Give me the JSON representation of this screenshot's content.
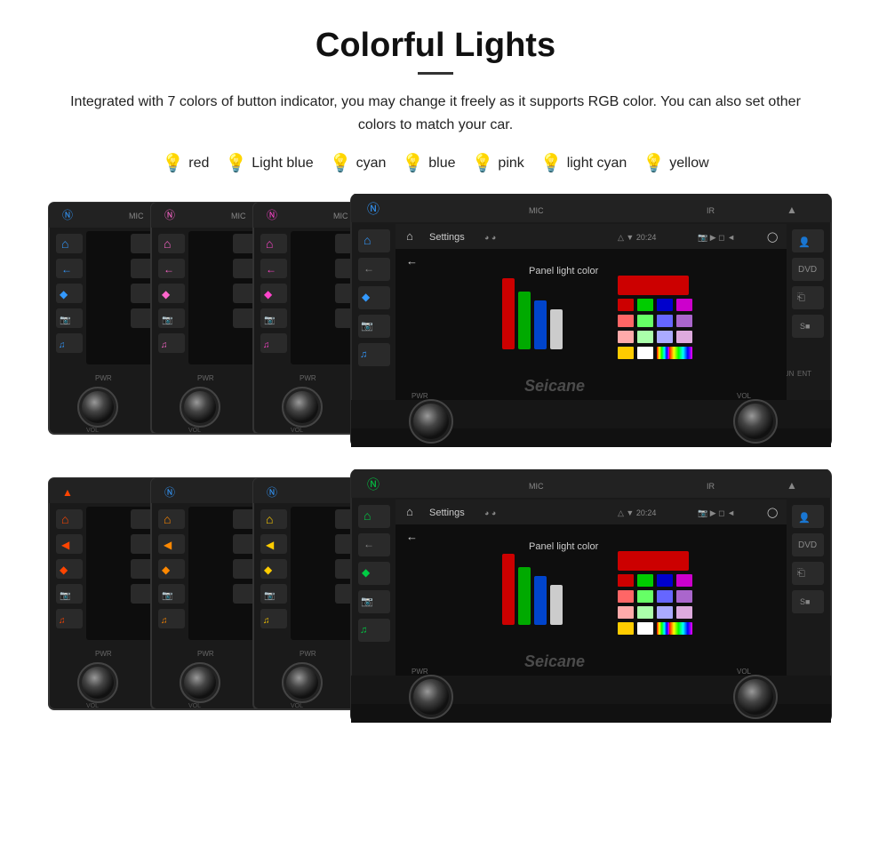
{
  "page": {
    "title": "Colorful Lights",
    "divider": "—",
    "description": "Integrated with 7 colors of button indicator, you may change it freely as it supports RGB color. You can also set other colors to match your car.",
    "colors": [
      {
        "id": "red",
        "label": "red",
        "hex": "#ff0066",
        "bulb": "🔴"
      },
      {
        "id": "light-blue",
        "label": "Light blue",
        "hex": "#66ccff",
        "bulb": "💡"
      },
      {
        "id": "cyan",
        "label": "cyan",
        "hex": "#00ffff",
        "bulb": "💡"
      },
      {
        "id": "blue",
        "label": "blue",
        "hex": "#3399ff",
        "bulb": "💡"
      },
      {
        "id": "pink",
        "label": "pink",
        "hex": "#ff66cc",
        "bulb": "💡"
      },
      {
        "id": "light-cyan",
        "label": "light cyan",
        "hex": "#99ffee",
        "bulb": "💡"
      },
      {
        "id": "yellow",
        "label": "yellow",
        "hex": "#ffff00",
        "bulb": "💡"
      }
    ],
    "watermark": "Seicane",
    "settings_label": "Settings",
    "panel_light_label": "Panel light color",
    "time_display": "20:24",
    "color_grid_top": [
      [
        "#cc0000",
        "#00cc00",
        "#0000cc",
        "#cc0000"
      ],
      [
        "#ff6666",
        "#66ff66",
        "#6666ff",
        "#cc66cc"
      ],
      [
        "#ffaaaa",
        "#aaffaa",
        "#aaaaff",
        "#ccaacc"
      ],
      [
        "#ffcc00",
        "#ffffff",
        "#ff99cc",
        "#9966ff"
      ]
    ],
    "color_grid_bottom": [
      [
        "#cc0000",
        "#00cc00",
        "#0000cc",
        "#cc0000"
      ],
      [
        "#ff6666",
        "#66ff66",
        "#6666ff",
        "#cc66cc"
      ],
      [
        "#ffaaaa",
        "#aaffaa",
        "#aaaaff",
        "#ccaacc"
      ],
      [
        "#ffcc00",
        "#ffffff",
        "#ff99cc",
        "#9966ff"
      ]
    ],
    "top_panel_colors": [
      "#3399ff",
      "#3399ff",
      "#ff66cc",
      "#ff66cc"
    ],
    "bottom_panel_colors": [
      "#ff4400",
      "#ff8800",
      "#ffcc00",
      "#00cc44"
    ]
  }
}
